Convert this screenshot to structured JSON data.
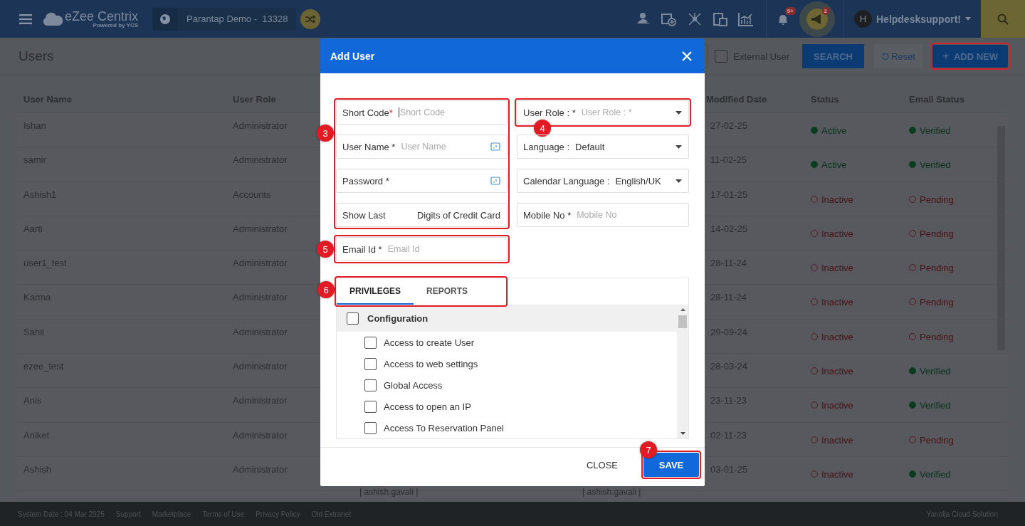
{
  "header": {
    "brand": "eZee Centrix",
    "brand_sub": "Powered by YCS",
    "property": "Parantap Demo -  13328",
    "notification_badge": "9+",
    "announcement_badge": "2",
    "avatar": "H",
    "user": "Helpdesksupport!"
  },
  "page": {
    "title": "Users",
    "external_user": {
      "label": "External User",
      "checked": false
    },
    "search_button": "SEARCH",
    "reset_button": "Reset",
    "add_button": {
      "icon": "+",
      "label": "ADD NEW",
      "highlighted": true
    }
  },
  "table": {
    "columns": [
      "User Name",
      "User Role",
      "",
      "",
      "Modified Date",
      "Status",
      "Email Status"
    ],
    "rows": [
      {
        "user_name": "Ishan",
        "user_role": "Administrator",
        "modified_date": "27-02-25",
        "status": {
          "label": "Active",
          "on": true
        },
        "email_status": {
          "label": "Verified",
          "on": true
        }
      },
      {
        "user_name": "samir",
        "user_role": "Administrator",
        "modified_date": "11-02-25",
        "status": {
          "label": "Active",
          "on": true
        },
        "email_status": {
          "label": "Verified",
          "on": true
        }
      },
      {
        "user_name": "Ashish1",
        "user_role": "Accounts",
        "modified_date": "17-01-25",
        "status": {
          "label": "Inactive",
          "on": false
        },
        "email_status": {
          "label": "Pending",
          "on": false
        }
      },
      {
        "user_name": "Aarti",
        "user_role": "Administrator",
        "modified_date": "14-02-25",
        "status": {
          "label": "Inactive",
          "on": false
        },
        "email_status": {
          "label": "Pending",
          "on": false
        }
      },
      {
        "user_name": "user1_test",
        "user_role": "Administrator",
        "modified_date": "28-11-24",
        "status": {
          "label": "Inactive",
          "on": false
        },
        "email_status": {
          "label": "Pending",
          "on": false
        }
      },
      {
        "user_name": "Karma",
        "user_role": "Administrator",
        "modified_date": "28-11-24",
        "status": {
          "label": "Inactive",
          "on": false
        },
        "email_status": {
          "label": "Pending",
          "on": false
        }
      },
      {
        "user_name": "Sahil",
        "user_role": "Administrator",
        "modified_date": "29-09-24",
        "status": {
          "label": "Inactive",
          "on": false
        },
        "email_status": {
          "label": "Pending",
          "on": false
        }
      },
      {
        "user_name": "ezee_test",
        "user_role": "Administrator",
        "modified_date": "28-03-24",
        "status": {
          "label": "Inactive",
          "on": false
        },
        "email_status": {
          "label": "Verified",
          "on": true
        }
      },
      {
        "user_name": "Anis",
        "user_role": "Administrator",
        "modified_date": "23-11-23",
        "status": {
          "label": "Inactive",
          "on": false
        },
        "email_status": {
          "label": "Verified",
          "on": true
        }
      },
      {
        "user_name": "Aniket",
        "user_role": "Administrator",
        "modified_date": "02-11-23",
        "status": {
          "label": "Inactive",
          "on": false
        },
        "email_status": {
          "label": "Pending",
          "on": false
        }
      },
      {
        "user_name": "Ashish",
        "user_role": "Administrator",
        "modified_date": "03-01-25",
        "status": {
          "label": "Inactive",
          "on": false
        },
        "email_status": {
          "label": "Verified",
          "on": true
        },
        "column_3": "| ashish.gavali |",
        "column_4": "| ashish.gavali |"
      }
    ]
  },
  "modal": {
    "title": "Add User",
    "left_fields": [
      {
        "kind": "text",
        "label": "Short Code",
        "required_mark": "*",
        "placeholder": "Short Code"
      },
      {
        "kind": "secret",
        "label": "User Name *",
        "placeholder": "User Name"
      },
      {
        "kind": "secret",
        "label": "Password *"
      },
      {
        "kind": "static",
        "label": "Show Last",
        "value": "Digits of Credit Card"
      }
    ],
    "left_annotation": "3",
    "right_fields": [
      {
        "kind": "select",
        "label": "User Role : *",
        "placeholder": "User Role : *",
        "annotation": "4"
      },
      {
        "kind": "select",
        "label": "Language :",
        "value": "Default"
      },
      {
        "kind": "select",
        "label": "Calendar Language :",
        "value": "English/UK"
      },
      {
        "kind": "text",
        "label": "Mobile No *",
        "placeholder": "Mobile No"
      }
    ],
    "email": {
      "label": "Email Id *",
      "placeholder": "Email Id",
      "annotation": "5"
    },
    "tabs": [
      {
        "label": "PRIVILEGES",
        "selected": true
      },
      {
        "label": "REPORTS",
        "selected": false
      }
    ],
    "tabs_annotation": "6",
    "privileges": [
      {
        "label": "Configuration",
        "checked": false,
        "children": [
          {
            "label": "Access to create User",
            "checked": false
          },
          {
            "label": "Access to web settings",
            "checked": false
          },
          {
            "label": "Global Access",
            "checked": false
          },
          {
            "label": "Access to open an IP",
            "checked": false
          },
          {
            "label": "Access To Reservation Panel",
            "checked": false
          }
        ]
      }
    ],
    "close_button": "CLOSE",
    "save_button": "SAVE",
    "save_annotation": "7"
  },
  "footer": {
    "links": [
      "System Date : 04 Mar 2025",
      "Support",
      "Marketplace",
      "Terms of Use",
      "Privacy Policy",
      "Old Extranet"
    ],
    "credit": "Yanolja Cloud Solution"
  }
}
